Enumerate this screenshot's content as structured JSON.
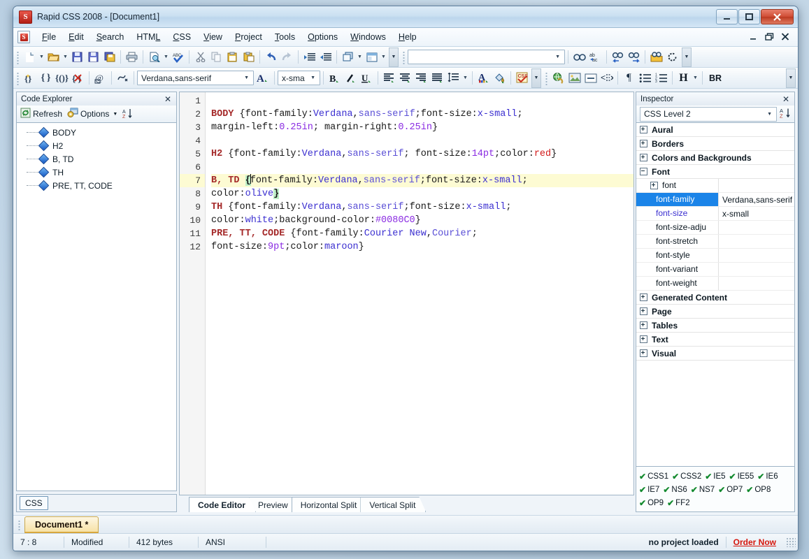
{
  "window": {
    "title": "Rapid CSS 2008 - [Document1]",
    "app_icon": "rapid-css-logo",
    "controls": {
      "minimize": "—",
      "maximize": "❐",
      "close": "✕"
    },
    "mdi_controls": {
      "minimize": "–",
      "restore": "❐",
      "close": "✕"
    }
  },
  "menu": {
    "items": [
      {
        "label": "File",
        "mnemonic": "F"
      },
      {
        "label": "Edit",
        "mnemonic": "E"
      },
      {
        "label": "Search",
        "mnemonic": "S"
      },
      {
        "label": "HTML",
        "mnemonic": "L"
      },
      {
        "label": "CSS",
        "mnemonic": "C"
      },
      {
        "label": "View",
        "mnemonic": "V"
      },
      {
        "label": "Project",
        "mnemonic": "P"
      },
      {
        "label": "Tools",
        "mnemonic": "T"
      },
      {
        "label": "Options",
        "mnemonic": "O"
      },
      {
        "label": "Windows",
        "mnemonic": "W"
      },
      {
        "label": "Help",
        "mnemonic": "H"
      }
    ]
  },
  "toolbar_row1": {
    "buttons": [
      "new-document-icon",
      "open-folder-icon",
      "save-icon",
      "save-as-icon",
      "save-all-icon",
      "print-icon",
      "print-preview-icon",
      "spell-check-icon",
      "cut-icon",
      "copy-icon",
      "paste-icon",
      "paste-special-icon",
      "undo-icon",
      "redo-icon",
      "indent-icon",
      "outdent-icon",
      "new-window-icon",
      "layout-icon"
    ],
    "address_value": "",
    "find_buttons": [
      "find-icon",
      "replace-icon",
      "find-previous-icon",
      "find-next-icon",
      "find-in-files-icon",
      "refresh-icon"
    ]
  },
  "toolbar_row2": {
    "buttons": [
      "magic-wand-icon",
      "braces-icon",
      "braces-paren-icon",
      "delete-style-icon",
      "at-rule-icon",
      "keyframe-icon"
    ],
    "font_family_value": "Verdana,sans-serif",
    "font_color_icon": "font-color-icon",
    "font_size_value": "x-sma",
    "format_buttons": [
      "bold-icon",
      "italic-icon",
      "underline-icon",
      "align-left-icon",
      "align-center-icon",
      "align-right-icon",
      "align-justify-icon",
      "line-height-icon",
      "text-color-icon",
      "background-fill-icon",
      "css-validate-icon"
    ],
    "insert_buttons": [
      "hyperlink-icon",
      "image-icon",
      "div-icon",
      "tag-icon",
      "paragraph-icon",
      "unordered-list-icon",
      "ordered-list-icon"
    ],
    "heading_label": "H",
    "br_label": "BR"
  },
  "code_explorer": {
    "caption": "Code Explorer",
    "close_icon": "close-icon",
    "refresh_label": "Refresh",
    "options_label": "Options",
    "sort_icon": "sort-az-icon",
    "items": [
      {
        "label": "BODY"
      },
      {
        "label": "H2"
      },
      {
        "label": "B, TD"
      },
      {
        "label": "TH"
      },
      {
        "label": "PRE, TT, CODE"
      }
    ],
    "mode_chip": "CSS"
  },
  "editor": {
    "lines": [
      {
        "n": "1",
        "highlight": false,
        "tokens": []
      },
      {
        "n": "2",
        "highlight": false,
        "tokens": [
          [
            "sel",
            "BODY"
          ],
          [
            "prop",
            " {font-family:"
          ],
          [
            "val",
            "Verdana"
          ],
          [
            "prop",
            ","
          ],
          [
            "val2",
            "sans-serif"
          ],
          [
            "prop",
            ";font-size:"
          ],
          [
            "val",
            "x-small"
          ],
          [
            "prop",
            ";"
          ]
        ]
      },
      {
        "n": "3",
        "highlight": false,
        "tokens": [
          [
            "prop",
            "margin-left:"
          ],
          [
            "num",
            "0.25in"
          ],
          [
            "prop",
            "; margin-right:"
          ],
          [
            "num",
            "0.25in"
          ],
          [
            "prop",
            "}"
          ]
        ]
      },
      {
        "n": "4",
        "highlight": false,
        "tokens": []
      },
      {
        "n": "5",
        "highlight": false,
        "tokens": [
          [
            "sel",
            "H2"
          ],
          [
            "prop",
            " {font-family:"
          ],
          [
            "val",
            "Verdana"
          ],
          [
            "prop",
            ","
          ],
          [
            "val2",
            "sans-serif"
          ],
          [
            "prop",
            "; font-size:"
          ],
          [
            "num",
            "14pt"
          ],
          [
            "prop",
            ";color:"
          ],
          [
            "red",
            "red"
          ],
          [
            "prop",
            "}"
          ]
        ]
      },
      {
        "n": "6",
        "highlight": false,
        "tokens": []
      },
      {
        "n": "7",
        "highlight": true,
        "tokens": [
          [
            "sel",
            "B, TD"
          ],
          [
            "prop",
            " "
          ],
          [
            "brace",
            "{"
          ],
          [
            "caret",
            ""
          ],
          [
            "prop",
            "font-family:"
          ],
          [
            "val",
            "Verdana"
          ],
          [
            "prop",
            ","
          ],
          [
            "val2",
            "sans-serif"
          ],
          [
            "prop",
            ";font-size:"
          ],
          [
            "val",
            "x-small"
          ],
          [
            "prop",
            ";"
          ]
        ]
      },
      {
        "n": "8",
        "highlight": false,
        "tokens": [
          [
            "prop",
            "color:"
          ],
          [
            "val",
            "olive"
          ],
          [
            "brace",
            "}"
          ]
        ]
      },
      {
        "n": "9",
        "highlight": false,
        "tokens": [
          [
            "sel",
            "TH"
          ],
          [
            "prop",
            " {font-family:"
          ],
          [
            "val",
            "Verdana"
          ],
          [
            "prop",
            ","
          ],
          [
            "val2",
            "sans-serif"
          ],
          [
            "prop",
            ";font-size:"
          ],
          [
            "val",
            "x-small"
          ],
          [
            "prop",
            ";"
          ]
        ]
      },
      {
        "n": "10",
        "highlight": false,
        "tokens": [
          [
            "prop",
            "color:"
          ],
          [
            "val",
            "white"
          ],
          [
            "prop",
            ";background-color:"
          ],
          [
            "num",
            "#0080C0"
          ],
          [
            "prop",
            "}"
          ]
        ]
      },
      {
        "n": "11",
        "highlight": false,
        "tokens": [
          [
            "sel",
            "PRE, TT, CODE"
          ],
          [
            "prop",
            " {font-family:"
          ],
          [
            "val",
            "Courier New"
          ],
          [
            "prop",
            ","
          ],
          [
            "val2",
            "Courier"
          ],
          [
            "prop",
            ";"
          ]
        ]
      },
      {
        "n": "12",
        "highlight": false,
        "tokens": [
          [
            "prop",
            "font-size:"
          ],
          [
            "num",
            "9pt"
          ],
          [
            "prop",
            ";color:"
          ],
          [
            "val",
            "maroon"
          ],
          [
            "prop",
            "}"
          ]
        ]
      }
    ],
    "tabs": [
      {
        "label": "Code Editor",
        "active": true
      },
      {
        "label": "Preview",
        "active": false
      },
      {
        "label": "Horizontal Split",
        "active": false
      },
      {
        "label": "Vertical Split",
        "active": false
      }
    ]
  },
  "inspector": {
    "caption": "Inspector",
    "close_icon": "close-icon",
    "level_value": "CSS Level 2",
    "sort_icon": "sort-az-icon",
    "groups": [
      {
        "label": "Aural",
        "expanded": false,
        "rows": []
      },
      {
        "label": "Borders",
        "expanded": false,
        "rows": []
      },
      {
        "label": "Colors and Backgrounds",
        "expanded": false,
        "rows": []
      },
      {
        "label": "Font",
        "expanded": true,
        "rows": [
          {
            "name": "font",
            "value": "",
            "sub": true,
            "selected": false
          },
          {
            "name": "font-family",
            "value": "Verdana,sans-serif",
            "sub": false,
            "selected": true
          },
          {
            "name": "font-size",
            "value": "x-small",
            "sub": false,
            "selected": false
          },
          {
            "name": "font-size-adju",
            "value": "",
            "sub": false,
            "selected": false,
            "plain": true
          },
          {
            "name": "font-stretch",
            "value": "",
            "sub": false,
            "selected": false,
            "plain": true
          },
          {
            "name": "font-style",
            "value": "",
            "sub": false,
            "selected": false,
            "plain": true
          },
          {
            "name": "font-variant",
            "value": "",
            "sub": false,
            "selected": false,
            "plain": true
          },
          {
            "name": "font-weight",
            "value": "",
            "sub": false,
            "selected": false,
            "plain": true
          }
        ]
      },
      {
        "label": "Generated Content",
        "expanded": false,
        "rows": []
      },
      {
        "label": "Page",
        "expanded": false,
        "rows": []
      },
      {
        "label": "Tables",
        "expanded": false,
        "rows": []
      },
      {
        "label": "Text",
        "expanded": false,
        "rows": []
      },
      {
        "label": "Visual",
        "expanded": false,
        "rows": []
      }
    ],
    "badges": [
      "CSS1",
      "CSS2",
      "IE5",
      "IE55",
      "IE6",
      "IE7",
      "NS6",
      "NS7",
      "OP7",
      "OP8",
      "OP9",
      "FF2"
    ],
    "badge_check": "✔"
  },
  "doc_tabs": [
    {
      "label": "Document1 *"
    }
  ],
  "statusbar": {
    "cursor_position": "7 : 8",
    "modified": "Modified",
    "size": "412 bytes",
    "encoding": "ANSI",
    "project": "no project loaded",
    "order_now": "Order Now"
  },
  "colors": {
    "accent_blue": "#1b84e8",
    "selector_red": "#a52a2a",
    "value_blue": "#3b2fd0",
    "number_purple": "#8a2be2",
    "highlight_line": "#fdfbd3",
    "order_now_red": "#d6170d",
    "check_green": "#138a2f"
  }
}
